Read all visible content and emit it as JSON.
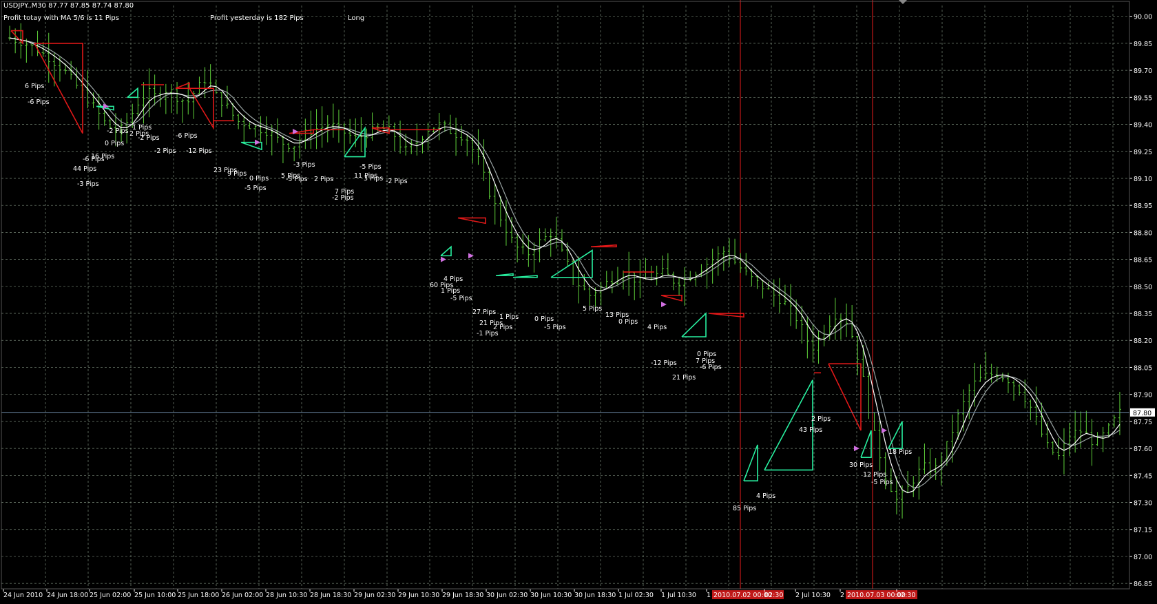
{
  "header": {
    "symbol_line": "USDJPY.,M30  87.77 87.85 87.74 87.80",
    "profit_today": "Profit totay with MA 5/6 is 11 Pips",
    "profit_yesterday": "Profit yesterday is 182 Pips",
    "position": "Long"
  },
  "colors": {
    "background": "#000000",
    "grid": "#7a8a7a",
    "frame": "#ffffff",
    "bars": "#5fd23a",
    "ma_fast": "#ffffff",
    "ma_slow": "#9aa4a4",
    "trade_loss": "#e01818",
    "trade_win": "#28f0a0",
    "trade_marker": "#d070e0",
    "price_line": "#6e8aa8",
    "vertical_marker": "#c01818",
    "date_highlight": "#c01818"
  },
  "chart_data": {
    "type": "candlestick",
    "symbol": "USDJPY.",
    "timeframe": "M30",
    "bid_label": "87.80",
    "y_axis_ticks": [
      "90.00",
      "89.85",
      "89.70",
      "89.55",
      "89.40",
      "89.25",
      "89.10",
      "88.95",
      "88.80",
      "88.65",
      "88.50",
      "88.35",
      "88.20",
      "88.05",
      "87.90",
      "87.75",
      "87.60",
      "87.45",
      "87.30",
      "87.15",
      "87.00",
      "86.85"
    ],
    "ylim": [
      86.82,
      90.06
    ],
    "x_axis_ticks": [
      "24 Jun 2010",
      "24 Jun 18:00",
      "25 Jun 02:00",
      "25 Jun 10:00",
      "25 Jun 18:00",
      "26 Jun 02:00",
      "28 Jun 10:30",
      "28 Jun 18:30",
      "29 Jun 02:30",
      "29 Jun 10:30",
      "29 Jun 18:30",
      "30 Jun 02:30",
      "30 Jun 10:30",
      "30 Jun 18:30",
      "1 Jul 02:30",
      "1 Jul 10:30",
      "1 2010.07.02 00:00",
      "02:30",
      "2 Jul 10:30",
      "2 2010.07.03 00:00",
      "02:30"
    ],
    "highlighted_dates": [
      "2010.07.02 00:00",
      "2010.07.03 00:00"
    ],
    "bars": 200,
    "close_path": [
      [
        0,
        89.88
      ],
      [
        8,
        89.84
      ],
      [
        15,
        89.78
      ],
      [
        22,
        89.7
      ],
      [
        28,
        89.6
      ],
      [
        34,
        89.5
      ],
      [
        39,
        89.4
      ],
      [
        44,
        89.35
      ],
      [
        48,
        89.42
      ],
      [
        52,
        89.52
      ],
      [
        56,
        89.58
      ],
      [
        60,
        89.55
      ],
      [
        64,
        89.6
      ],
      [
        68,
        89.55
      ],
      [
        72,
        89.52
      ],
      [
        76,
        89.6
      ],
      [
        80,
        89.66
      ],
      [
        84,
        89.55
      ],
      [
        88,
        89.5
      ],
      [
        92,
        89.42
      ],
      [
        96,
        89.4
      ],
      [
        100,
        89.38
      ],
      [
        105,
        89.36
      ],
      [
        110,
        89.3
      ],
      [
        115,
        89.28
      ],
      [
        120,
        89.35
      ],
      [
        125,
        89.38
      ],
      [
        130,
        89.4
      ],
      [
        135,
        89.36
      ],
      [
        140,
        89.32
      ],
      [
        145,
        89.35
      ],
      [
        150,
        89.38
      ],
      [
        155,
        89.36
      ],
      [
        160,
        89.25
      ],
      [
        165,
        89.3
      ],
      [
        170,
        89.38
      ],
      [
        175,
        89.4
      ],
      [
        180,
        89.35
      ],
      [
        185,
        89.33
      ],
      [
        190,
        89.2
      ],
      [
        195,
        89.0
      ],
      [
        200,
        88.85
      ],
      [
        205,
        88.72
      ],
      [
        210,
        88.68
      ],
      [
        215,
        88.75
      ],
      [
        220,
        88.8
      ],
      [
        225,
        88.65
      ],
      [
        230,
        88.52
      ],
      [
        235,
        88.45
      ],
      [
        240,
        88.5
      ],
      [
        245,
        88.55
      ],
      [
        250,
        88.58
      ],
      [
        255,
        88.52
      ],
      [
        260,
        88.55
      ],
      [
        265,
        88.58
      ],
      [
        270,
        88.52
      ],
      [
        275,
        88.55
      ],
      [
        280,
        88.6
      ],
      [
        285,
        88.65
      ],
      [
        290,
        88.7
      ],
      [
        295,
        88.62
      ],
      [
        300,
        88.55
      ],
      [
        305,
        88.5
      ],
      [
        310,
        88.45
      ],
      [
        315,
        88.4
      ],
      [
        320,
        88.3
      ],
      [
        325,
        88.15
      ],
      [
        330,
        88.25
      ],
      [
        335,
        88.35
      ],
      [
        340,
        88.3
      ],
      [
        345,
        88.05
      ],
      [
        350,
        87.7
      ],
      [
        355,
        87.45
      ],
      [
        360,
        87.3
      ],
      [
        365,
        87.4
      ],
      [
        370,
        87.5
      ],
      [
        375,
        87.48
      ],
      [
        380,
        87.62
      ],
      [
        385,
        87.8
      ],
      [
        390,
        87.95
      ],
      [
        395,
        88.0
      ],
      [
        400,
        88.02
      ],
      [
        405,
        87.98
      ],
      [
        410,
        87.92
      ],
      [
        415,
        87.8
      ],
      [
        420,
        87.62
      ],
      [
        425,
        87.55
      ],
      [
        430,
        87.68
      ],
      [
        435,
        87.7
      ],
      [
        440,
        87.62
      ],
      [
        445,
        87.7
      ],
      [
        450,
        87.8
      ]
    ],
    "annotations": [
      "6 Pips",
      "-6 Pips",
      "44 Pips",
      "-3 Pips",
      "-6 Pips",
      "16 Pips",
      "0 Pips",
      "-2 Pips",
      "1 Pips",
      "2 Pips",
      "-2 Pips",
      "-2 Pips",
      "-12 Pips",
      "-6 Pips",
      "23 Pips",
      "9 Pips",
      "0 Pips",
      "-5 Pips",
      "5 Pips",
      "-5 Pips",
      "-3 Pips",
      "2 Pips",
      "7 Pips",
      "-2 Pips",
      "11 Pips",
      "-5 Pips",
      "3 Pips",
      "-2 Pips",
      "60 Pips",
      "4 Pips",
      "1 Pips",
      "-5 Pips",
      "27 Pips",
      "21 Pips",
      "-1 Pips",
      "2 Pips",
      "1 Pips",
      "0 Pips",
      "-5 Pips",
      "5 Pips",
      "13 Pips",
      "0 Pips",
      "4 Pips",
      "-12 Pips",
      "21 Pips",
      "0 Pips",
      "7 Pips",
      "-6 Pips",
      "85 Pips",
      "4 Pips",
      "43 Pips",
      "2 Pips",
      "30 Pips",
      "12 Pips",
      "-5 Pips",
      "18 Pips"
    ]
  }
}
